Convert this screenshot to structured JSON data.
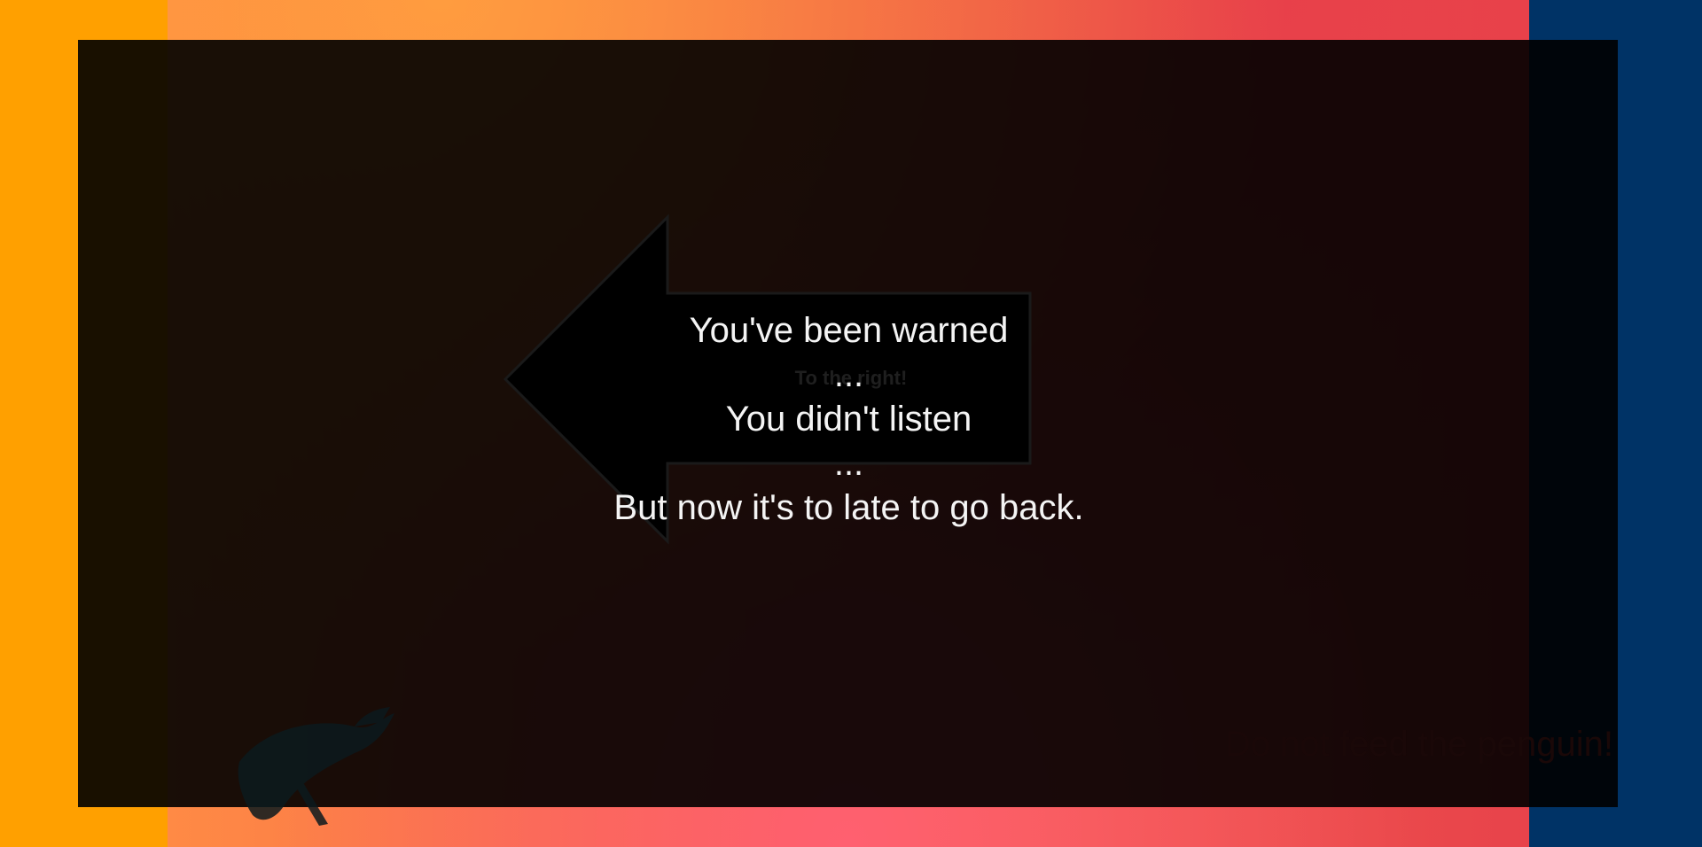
{
  "page": {
    "arrow_label": "To the right!",
    "message_lines": [
      "You've been warned",
      "...",
      "You didn't listen",
      "...",
      "But now it's to late to go back."
    ],
    "footer_text": "Do not feed the penguin!"
  },
  "icons": {
    "arrow": "left-arrow-icon",
    "penguin": "penguin-icon"
  },
  "colors": {
    "left_bar": "#ffa000",
    "right_bar": "#003366",
    "overlay": "#000000",
    "message_text": "#f4f4f4"
  }
}
